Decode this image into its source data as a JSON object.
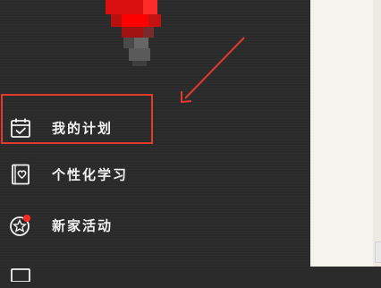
{
  "menu": {
    "items": [
      {
        "label": "我的计划",
        "icon": "calendar-check-icon"
      },
      {
        "label": "个性化学习",
        "icon": "heart-book-icon"
      },
      {
        "label": "新家活动",
        "icon": "star-circle-icon",
        "badge": "red-dot"
      },
      {
        "label": "",
        "icon": "partial-item-icon"
      }
    ]
  },
  "annotation": {
    "highlight_color": "#e23a2e",
    "arrow_color": "#e23a2e"
  },
  "colors": {
    "drawer_background": "#2a2a2a",
    "content_background": "#f5f3ee",
    "text": "#f2f2f2",
    "avatar_red": "#ff0000"
  }
}
